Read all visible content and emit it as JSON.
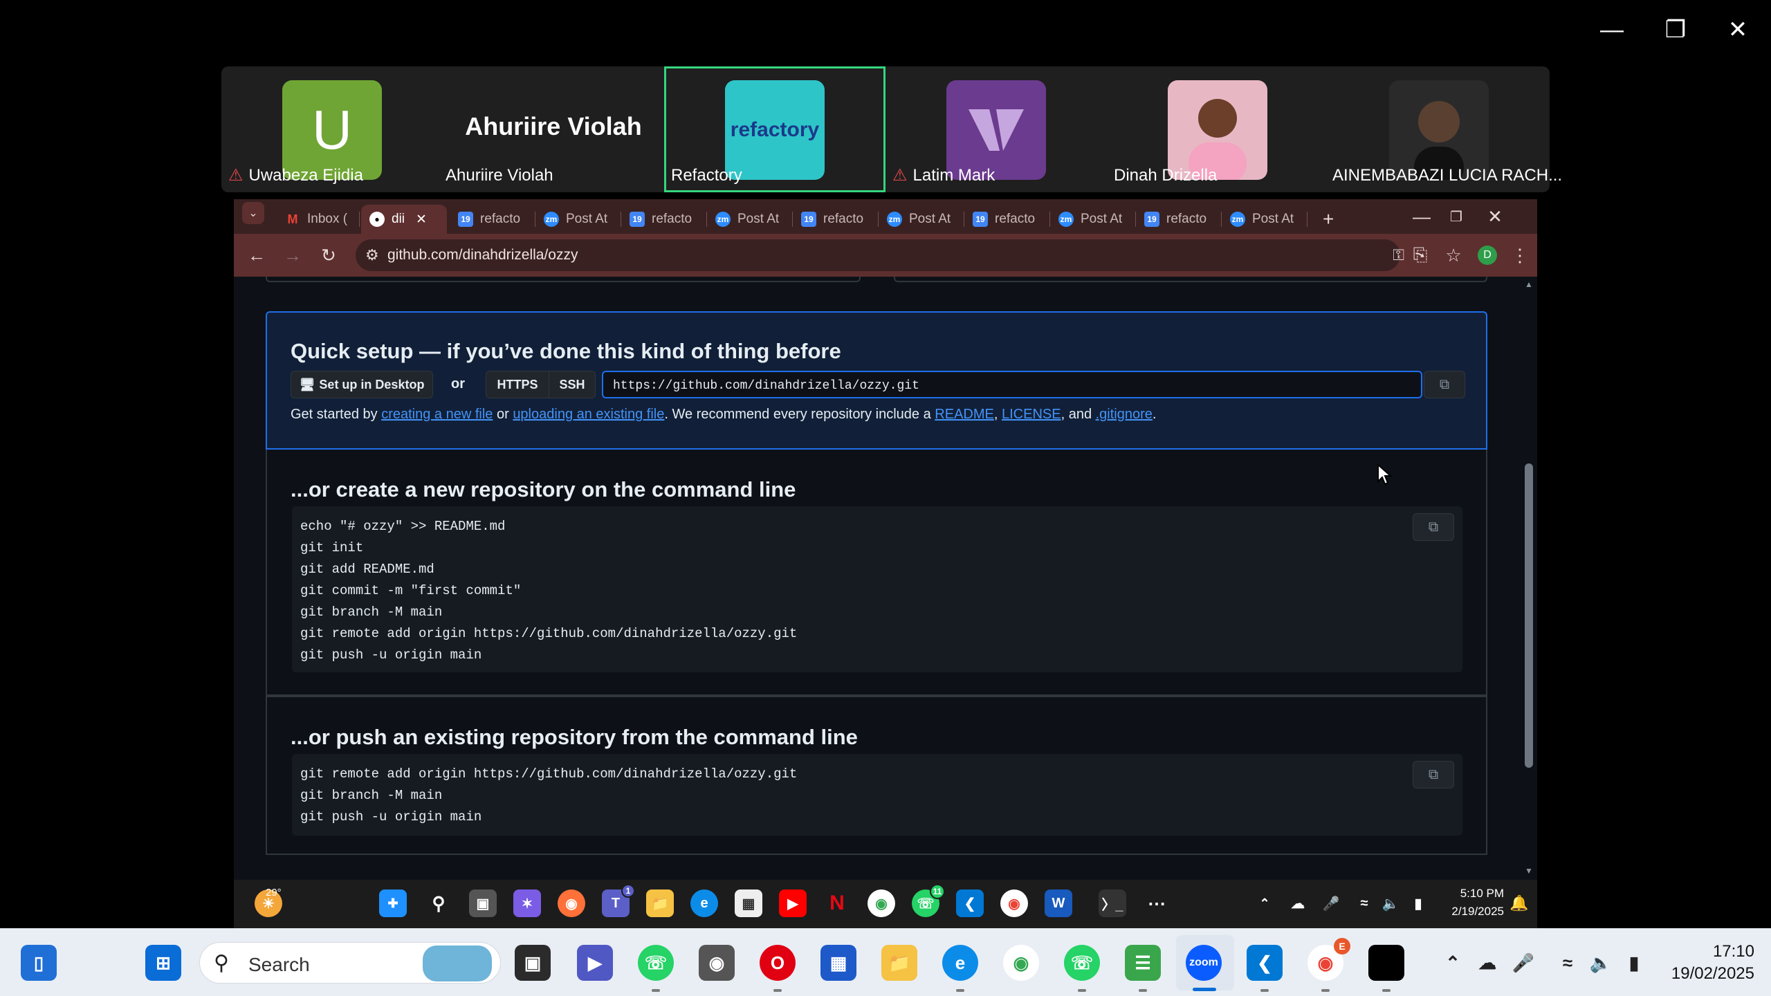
{
  "participants": [
    {
      "name": "Uwabeza Ejidia",
      "initial": "U",
      "muted": true
    },
    {
      "name": "Ahuriire Violah",
      "display_title": "Ahuriire Violah",
      "muted": false
    },
    {
      "name": "Refactory",
      "logo_text": "refactory",
      "muted": false,
      "active": true
    },
    {
      "name": "Latim Mark",
      "muted": true
    },
    {
      "name": "Dinah Drizella",
      "muted": false
    },
    {
      "name": "AINEMBABAZI LUCIA RACH...",
      "muted": false
    }
  ],
  "browser": {
    "tabs": [
      {
        "label": "Inbox (",
        "icon": "gmail-icon"
      },
      {
        "label": "dii",
        "icon": "github-icon",
        "active": true
      },
      {
        "label": "refacto",
        "icon": "calendar-icon"
      },
      {
        "label": "Post At",
        "icon": "zoom-icon"
      },
      {
        "label": "refacto",
        "icon": "calendar-icon"
      },
      {
        "label": "Post At",
        "icon": "zoom-icon"
      },
      {
        "label": "refacto",
        "icon": "calendar-icon"
      },
      {
        "label": "Post At",
        "icon": "zoom-icon"
      },
      {
        "label": "refacto",
        "icon": "calendar-icon"
      },
      {
        "label": "Post At",
        "icon": "zoom-icon"
      },
      {
        "label": "refacto",
        "icon": "calendar-icon"
      },
      {
        "label": "Post At",
        "icon": "zoom-icon"
      }
    ],
    "url": "github.com/dinahdrizella/ozzy",
    "profile_initial": "D"
  },
  "quick_setup": {
    "title": "Quick setup — if you’ve done this kind of thing before",
    "desktop_button": "Set up in Desktop",
    "or": "or",
    "https": "HTTPS",
    "ssh": "SSH",
    "clone_url": "https://github.com/dinahdrizella/ozzy.git",
    "get_started": "Get started by",
    "link_new_file": "creating a new file",
    "or_text": "or",
    "link_upload": "uploading an existing file",
    "recommend": ". We recommend every repository include a",
    "link_readme": "README",
    "comma": ",",
    "link_license": "LICENSE",
    "and_text": ", and",
    "link_gitignore": ".gitignore",
    "period": "."
  },
  "create_section": {
    "title": "...or create a new repository on the command line",
    "lines": [
      "echo \"# ozzy\" >> README.md",
      "git init",
      "git add README.md",
      "git commit -m \"first commit\"",
      "git branch -M main",
      "git remote add origin https://github.com/dinahdrizella/ozzy.git",
      "git push -u origin main"
    ]
  },
  "push_section": {
    "title": "...or push an existing repository from the command line",
    "lines": [
      "git remote add origin https://github.com/dinahdrizella/ozzy.git",
      "git branch -M main",
      "git push -u origin main"
    ]
  },
  "remote_taskbar": {
    "weather": "29°",
    "time": "5:10 PM",
    "date": "2/19/2025",
    "teams_badge": "1",
    "whatsapp_badge": "11"
  },
  "taskbar": {
    "search_placeholder": "Search",
    "time": "17:10",
    "date": "19/02/2025",
    "chrome_badge": "E"
  },
  "colors": {
    "github_bg": "#0d1117",
    "link": "#4493f8",
    "active_speaker": "#35d67f",
    "browser_frame": "#5e2f2f"
  }
}
